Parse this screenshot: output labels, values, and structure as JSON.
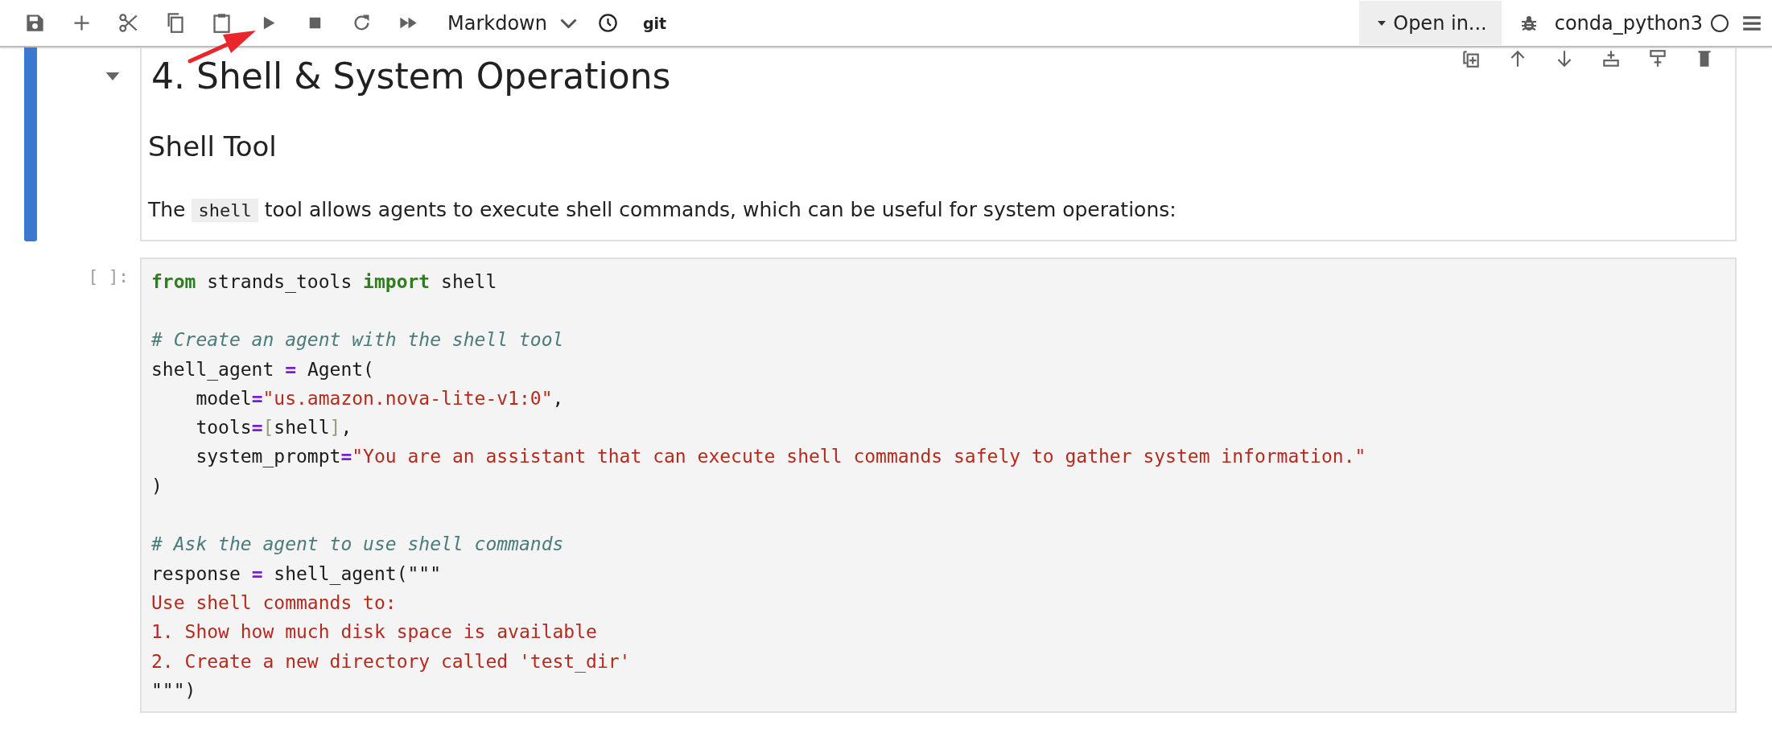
{
  "toolbar": {
    "buttons": [
      {
        "kind": "save"
      },
      {
        "kind": "add"
      },
      {
        "kind": "cut"
      },
      {
        "kind": "copy"
      },
      {
        "kind": "paste"
      },
      {
        "kind": "run"
      },
      {
        "kind": "stop"
      },
      {
        "kind": "restart"
      },
      {
        "kind": "run-all"
      }
    ],
    "cell_type": "Markdown",
    "history": {
      "kind": "clock"
    },
    "git": "git",
    "open_in": "Open in...",
    "kernel": {
      "name": "conda_python3",
      "busy": false
    }
  },
  "markdown_cell": {
    "selected": true,
    "expanded": true,
    "actions": [
      {
        "kind": "duplicate"
      },
      {
        "kind": "move-up"
      },
      {
        "kind": "move-down"
      },
      {
        "kind": "insert-above"
      },
      {
        "kind": "insert-below"
      },
      {
        "kind": "delete"
      }
    ],
    "heading": "4. Shell & System Operations",
    "subheading": "Shell Tool",
    "paragraph": [
      {
        "kind": "text",
        "text": "The "
      },
      {
        "kind": "code",
        "text": "shell"
      },
      {
        "kind": "text",
        "text": " tool allows agents to execute shell commands, which can be useful for system operations:"
      }
    ]
  },
  "code_cell": {
    "prompt": "[ ]:",
    "lines": [
      {
        "kind": "code",
        "tokens": [
          {
            "kind": "keyword",
            "text": "from"
          },
          {
            "kind": "plain",
            "text": " strands_tools "
          },
          {
            "kind": "keyword",
            "text": "import"
          },
          {
            "kind": "plain",
            "text": " shell"
          }
        ]
      },
      {
        "kind": "blank"
      },
      {
        "kind": "code",
        "tokens": [
          {
            "kind": "comment",
            "text": "# Create an agent with the shell tool"
          }
        ]
      },
      {
        "kind": "code",
        "tokens": [
          {
            "kind": "plain",
            "text": "shell_agent "
          },
          {
            "kind": "operator",
            "text": "="
          },
          {
            "kind": "plain",
            "text": " Agent("
          }
        ]
      },
      {
        "kind": "code",
        "tokens": [
          {
            "kind": "plain",
            "text": "    model"
          },
          {
            "kind": "operator",
            "text": "="
          },
          {
            "kind": "string",
            "text": "\"us.amazon.nova-lite-v1:0\""
          },
          {
            "kind": "plain",
            "text": ","
          }
        ]
      },
      {
        "kind": "code",
        "tokens": [
          {
            "kind": "plain",
            "text": "    tools"
          },
          {
            "kind": "operator",
            "text": "="
          },
          {
            "kind": "bracket",
            "text": "["
          },
          {
            "kind": "plain",
            "text": "shell"
          },
          {
            "kind": "bracket",
            "text": "]"
          },
          {
            "kind": "plain",
            "text": ","
          }
        ]
      },
      {
        "kind": "code",
        "tokens": [
          {
            "kind": "plain",
            "text": "    system_prompt"
          },
          {
            "kind": "operator",
            "text": "="
          },
          {
            "kind": "string",
            "text": "\"You are an assistant that can execute shell commands safely to gather system information.\""
          }
        ]
      },
      {
        "kind": "code",
        "tokens": [
          {
            "kind": "plain",
            "text": ")"
          }
        ]
      },
      {
        "kind": "blank"
      },
      {
        "kind": "code",
        "tokens": [
          {
            "kind": "comment",
            "text": "# Ask the agent to use shell commands"
          }
        ]
      },
      {
        "kind": "code",
        "tokens": [
          {
            "kind": "plain",
            "text": "response "
          },
          {
            "kind": "operator",
            "text": "="
          },
          {
            "kind": "plain",
            "text": " shell_agent(\"\"\""
          }
        ]
      },
      {
        "kind": "code",
        "tokens": [
          {
            "kind": "string",
            "text": "Use shell commands to:"
          }
        ]
      },
      {
        "kind": "code",
        "tokens": [
          {
            "kind": "string",
            "text": "1. Show how much disk space is available"
          }
        ]
      },
      {
        "kind": "code",
        "tokens": [
          {
            "kind": "string",
            "text": "2. Create a new directory called 'test_dir'"
          }
        ]
      },
      {
        "kind": "code",
        "tokens": [
          {
            "kind": "plain",
            "text": "\"\"\")"
          }
        ]
      }
    ]
  },
  "annotations": [
    {
      "kind": "arrow",
      "color": "#e8262b"
    }
  ]
}
